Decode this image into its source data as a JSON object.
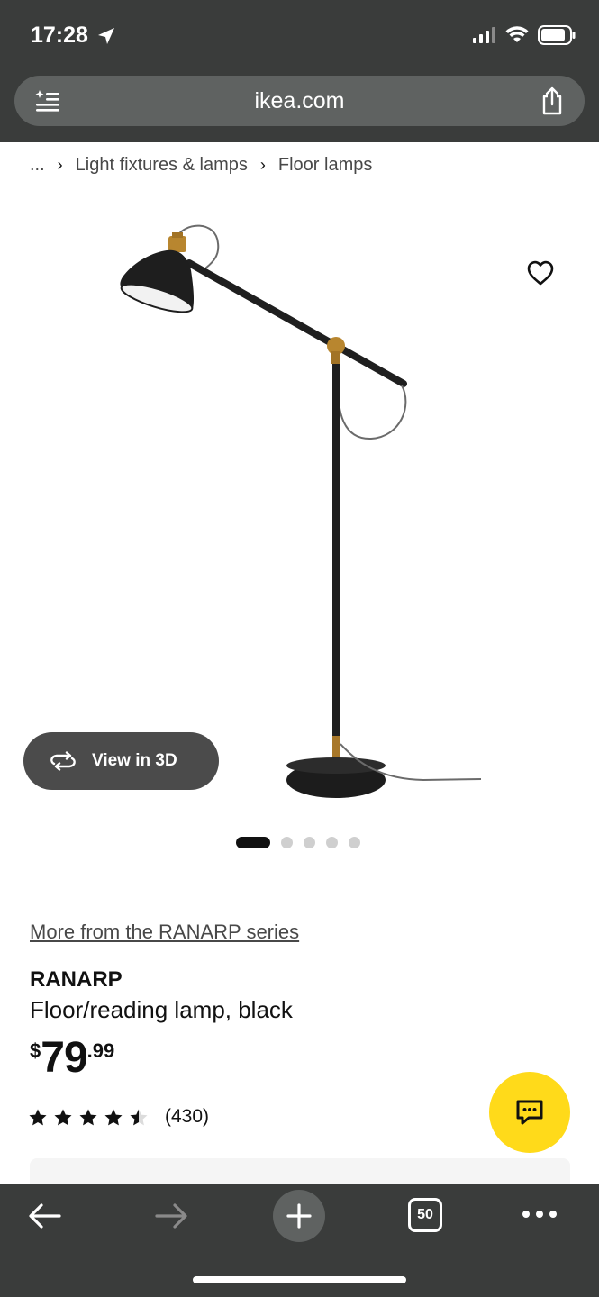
{
  "status_bar": {
    "time": "17:28"
  },
  "browser": {
    "url": "ikea.com",
    "tab_count": "50"
  },
  "breadcrumb": {
    "ellipsis": "...",
    "items": [
      "Light fixtures & lamps",
      "Floor lamps"
    ]
  },
  "gallery": {
    "view3d_label": "View in 3D",
    "image_count": 5,
    "active_index": 0
  },
  "product": {
    "series_link": "More from the RANARP series",
    "name": "RANARP",
    "description": "Floor/reading lamp, black",
    "price_currency": "$",
    "price_integer": "79",
    "price_decimal": ".99",
    "rating_value": 4.5,
    "rating_max": 5,
    "review_count": "(430)"
  },
  "colors": {
    "chrome": "#3a3c3b",
    "chat_button": "#ffda1a"
  }
}
